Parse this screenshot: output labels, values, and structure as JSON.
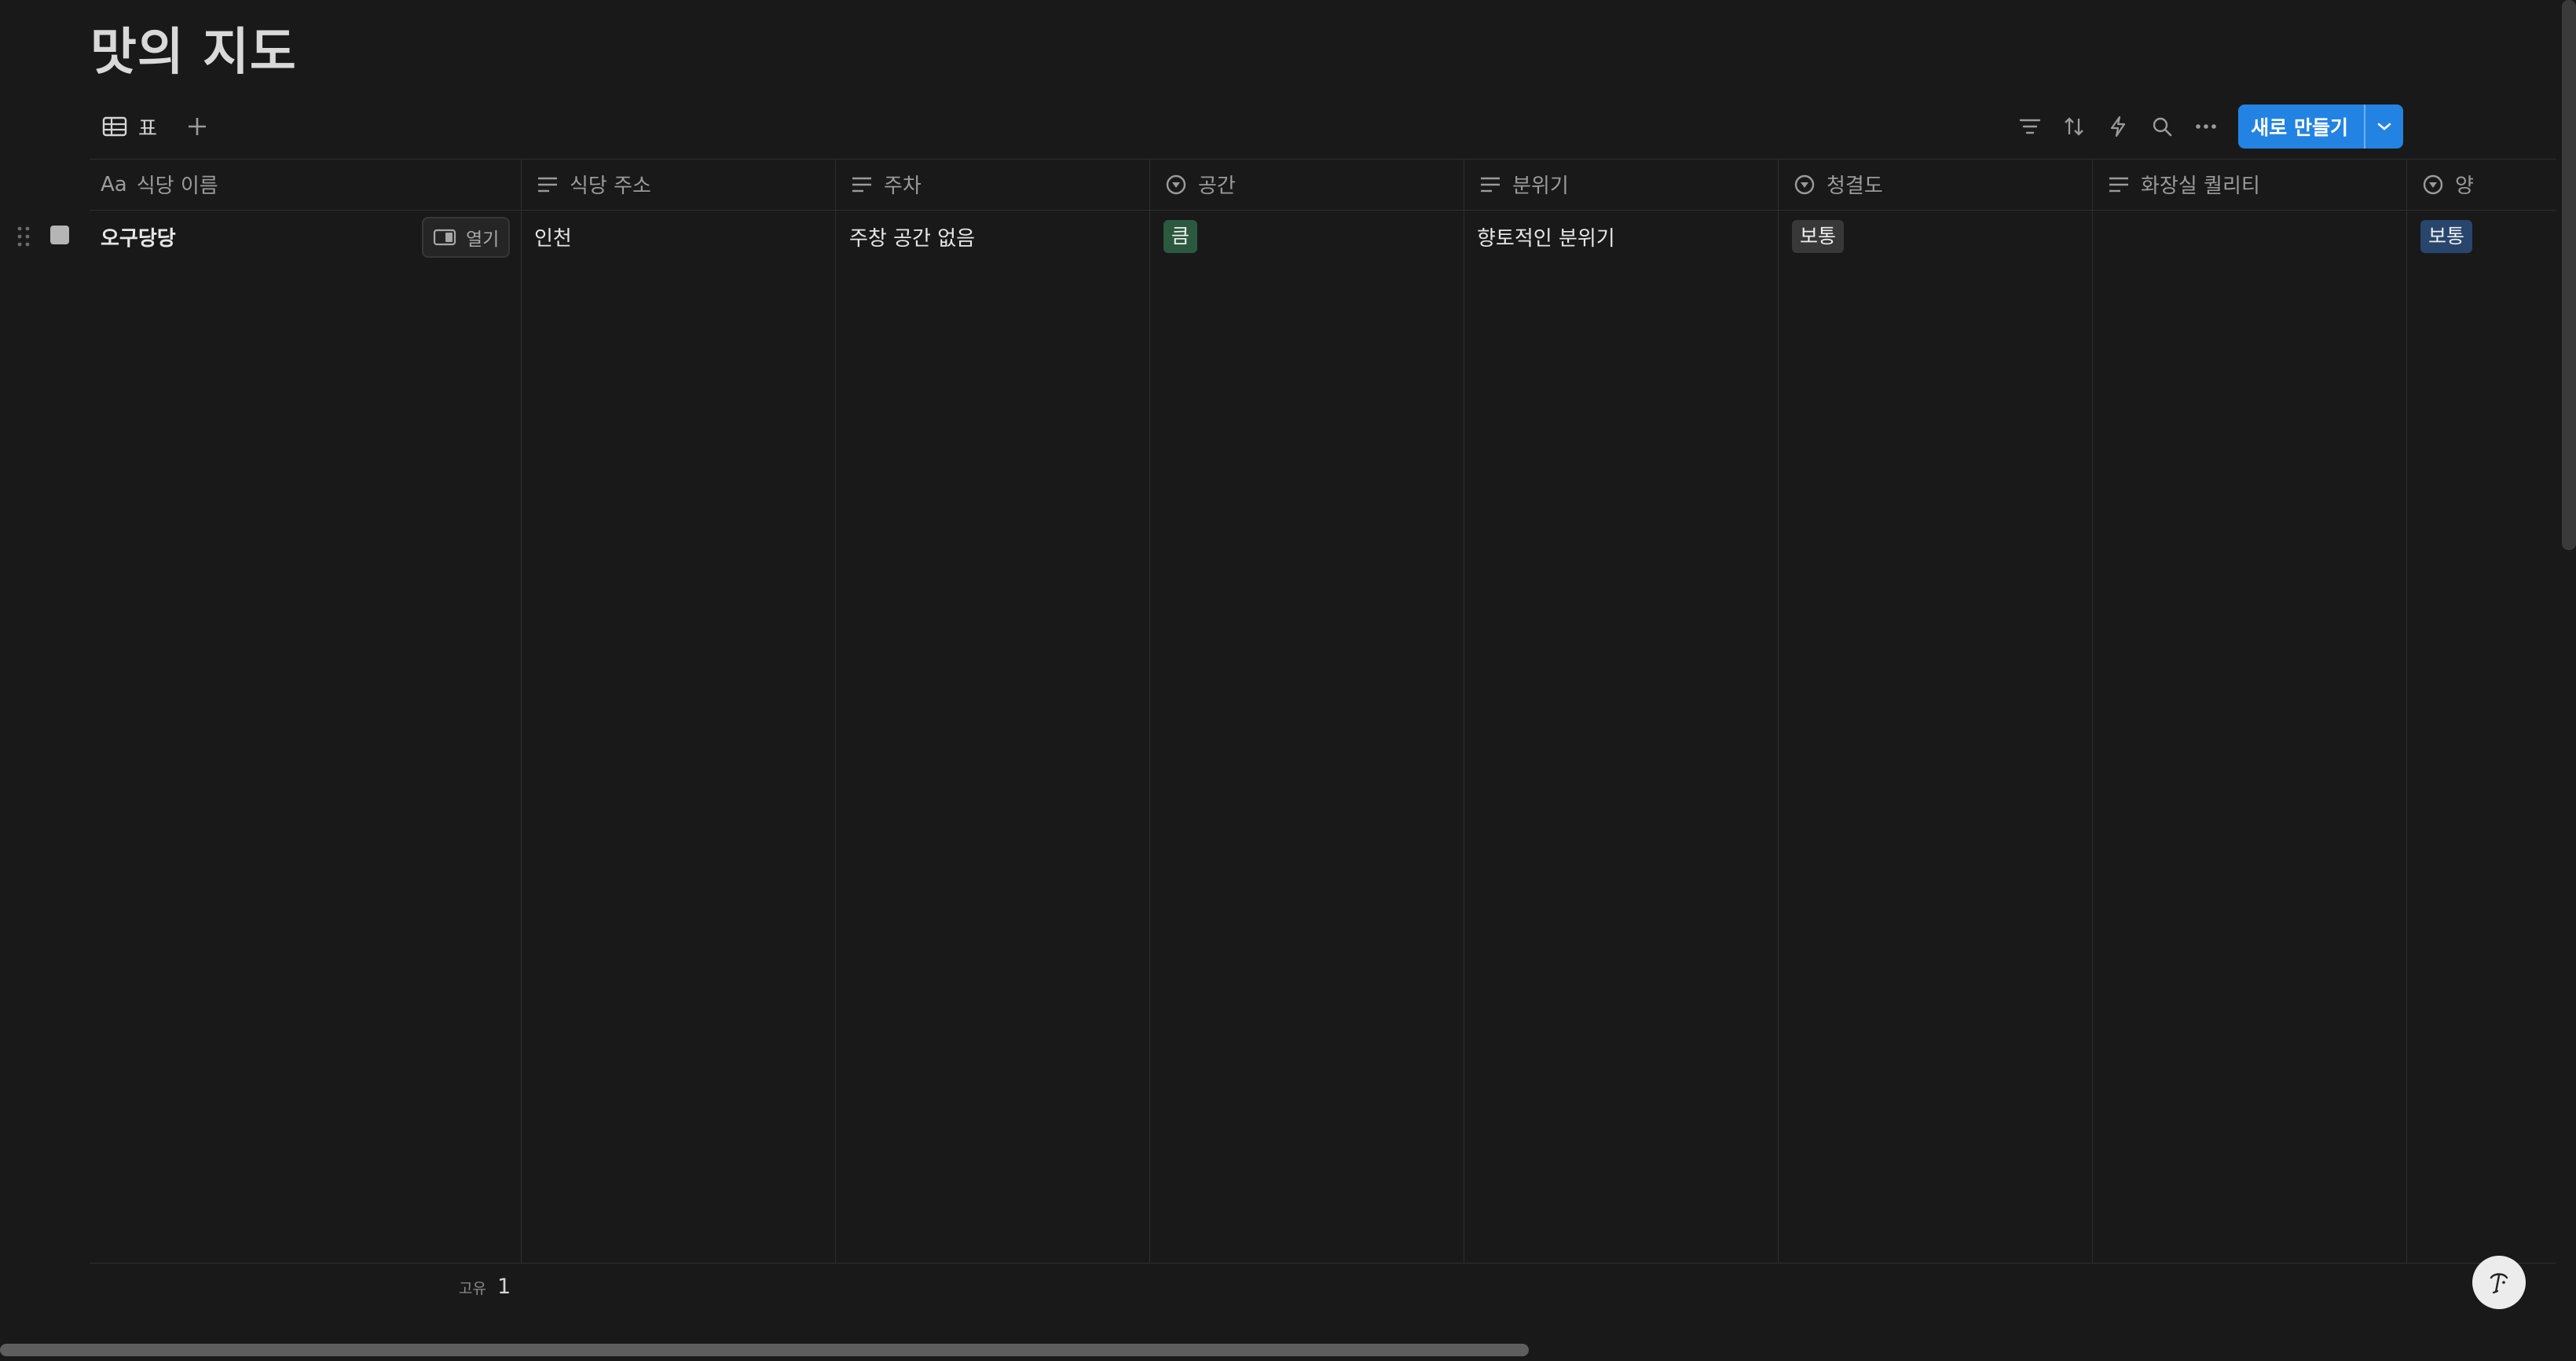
{
  "page": {
    "title": "맛의 지도"
  },
  "views": {
    "active_tab": "표",
    "icons": {
      "table": "table-icon",
      "add": "plus-icon"
    }
  },
  "toolbar": {
    "icons": [
      "filter-icon",
      "sort-icon",
      "automation-bolt-icon",
      "search-icon",
      "more-icon"
    ],
    "new_button_label": "새로 만들기"
  },
  "table": {
    "columns": [
      {
        "label": "식당 이름",
        "type_icon": "title-aa-icon"
      },
      {
        "label": "식당 주소",
        "type_icon": "text-lines-icon"
      },
      {
        "label": "주차",
        "type_icon": "text-lines-icon"
      },
      {
        "label": "공간",
        "type_icon": "select-icon"
      },
      {
        "label": "분위기",
        "type_icon": "text-lines-icon"
      },
      {
        "label": "청결도",
        "type_icon": "select-icon"
      },
      {
        "label": "화장실 퀄리티",
        "type_icon": "text-lines-icon"
      },
      {
        "label": "양",
        "type_icon": "select-icon"
      }
    ],
    "title_type_label": "Aa",
    "open_label": "열기",
    "rows": [
      {
        "name": "오구당당",
        "address": "인천",
        "parking": "주창 공간 없음",
        "space": "큼",
        "mood": "향토적인 분위기",
        "cleanliness": "보통",
        "restroom": "",
        "portion": "보통"
      }
    ],
    "tag_colors": {
      "green": "#2b593f",
      "gray": "#383838",
      "blue": "#28456c"
    }
  },
  "footer": {
    "label": "고유",
    "value": "1"
  },
  "colors": {
    "background": "#191919",
    "accent": "#2383e2",
    "grid": "#2f2f2f"
  }
}
